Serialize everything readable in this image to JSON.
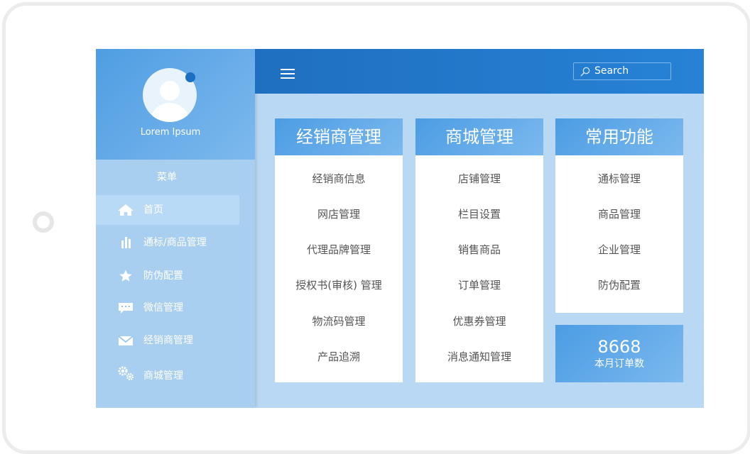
{
  "profile": {
    "name": "Lorem Ipsum"
  },
  "sidebar": {
    "title": "菜单",
    "items": [
      {
        "label": "首页",
        "icon": "home-icon"
      },
      {
        "label": "通标/商品管理",
        "icon": "bar-chart-icon"
      },
      {
        "label": "防伪配置",
        "icon": "star-icon"
      },
      {
        "label": "微信管理",
        "icon": "chat-icon"
      },
      {
        "label": "经销商管理",
        "icon": "mail-icon"
      },
      {
        "label": "商城管理",
        "icon": "gears-icon"
      }
    ]
  },
  "header": {
    "menu_icon": "hamburger-icon",
    "search": {
      "placeholder": "Search",
      "icon": "search-icon"
    }
  },
  "cards": [
    {
      "title": "经销商管理",
      "items": [
        "经销商信息",
        "网店管理",
        "代理品牌管理",
        "授权书(审核) 管理",
        "物流码管理",
        "产品追溯"
      ]
    },
    {
      "title": "商城管理",
      "items": [
        "店铺管理",
        "栏目设置",
        "销售商品",
        "订单管理",
        "优惠券管理",
        "消息通知管理"
      ]
    },
    {
      "title": "常用功能",
      "items": [
        "通标管理",
        "商品管理",
        "企业管理",
        "防伪配置"
      ]
    }
  ],
  "stats": {
    "value": "8668",
    "label": "本月订单数"
  },
  "colors": {
    "header": "#1f6fc0",
    "accent": "#4c9ce4",
    "sidebar": "#a8cef0",
    "background": "#b9d8f3"
  }
}
